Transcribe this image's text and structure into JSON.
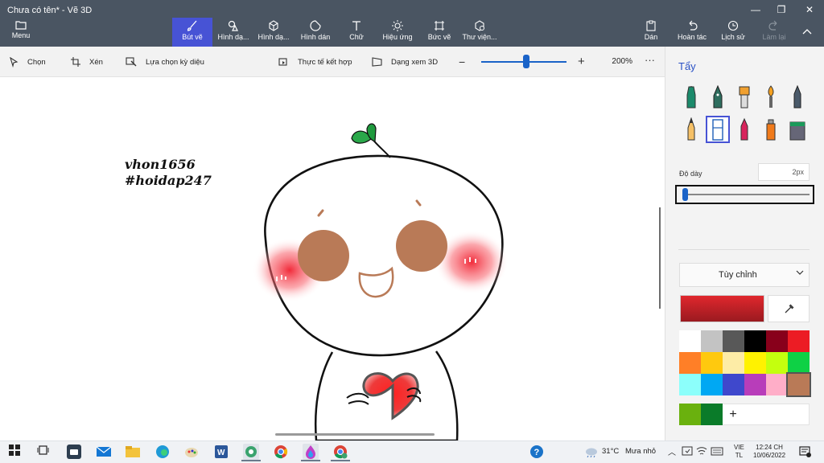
{
  "window": {
    "title": "Chưa có tên* - Vẽ 3D"
  },
  "ribbon": {
    "menu": "Menu",
    "brushes": "Bút vẽ",
    "shapes_2d": "Hình dạ...",
    "shapes_3d": "Hình dạ...",
    "stickers": "Hình dán",
    "text": "Chữ",
    "effects": "Hiệu ứng",
    "canvas": "Bức vẽ",
    "library": "Thư viện...",
    "paste": "Dán",
    "undo": "Hoàn tác",
    "history": "Lịch sử",
    "redo": "Làm lại"
  },
  "toolbar": {
    "select": "Chọn",
    "crop": "Xén",
    "magic_select": "Lựa chọn kỳ diệu",
    "mixed_reality": "Thực tế kết hợp",
    "view_3d": "Dạng xem 3D",
    "zoom_level": "200%",
    "zoom_slider_fraction": 0.53
  },
  "canvas": {
    "watermark_line1": "vhon1656",
    "watermark_line2": "#hoidap247"
  },
  "panel": {
    "title": "Tẩy",
    "thickness_label": "Độ dày",
    "thickness_value": "2px",
    "thickness_fraction": 0.02,
    "palette_dropdown": "Tùy chỉnh",
    "current_color": "#e0272d",
    "palette": [
      "#ffffff",
      "#c3c3c3",
      "#585858",
      "#000000",
      "#88001b",
      "#ec1c24",
      "#ff7f27",
      "#ffc90e",
      "#fdeca6",
      "#fff200",
      "#c4ff0e",
      "#0ed145",
      "#8cfffb",
      "#00a8f3",
      "#3f48cc",
      "#b83dba",
      "#ffaec8",
      "#b97a57"
    ],
    "custom_colors": [
      "#6ab10e",
      "#0a7b29"
    ]
  },
  "taskbar": {
    "weather_temp": "31°C",
    "weather_text": "Mưa nhỏ",
    "lang_1": "VIE",
    "lang_2": "TL",
    "time": "12:24 CH",
    "date": "10/06/2022"
  }
}
